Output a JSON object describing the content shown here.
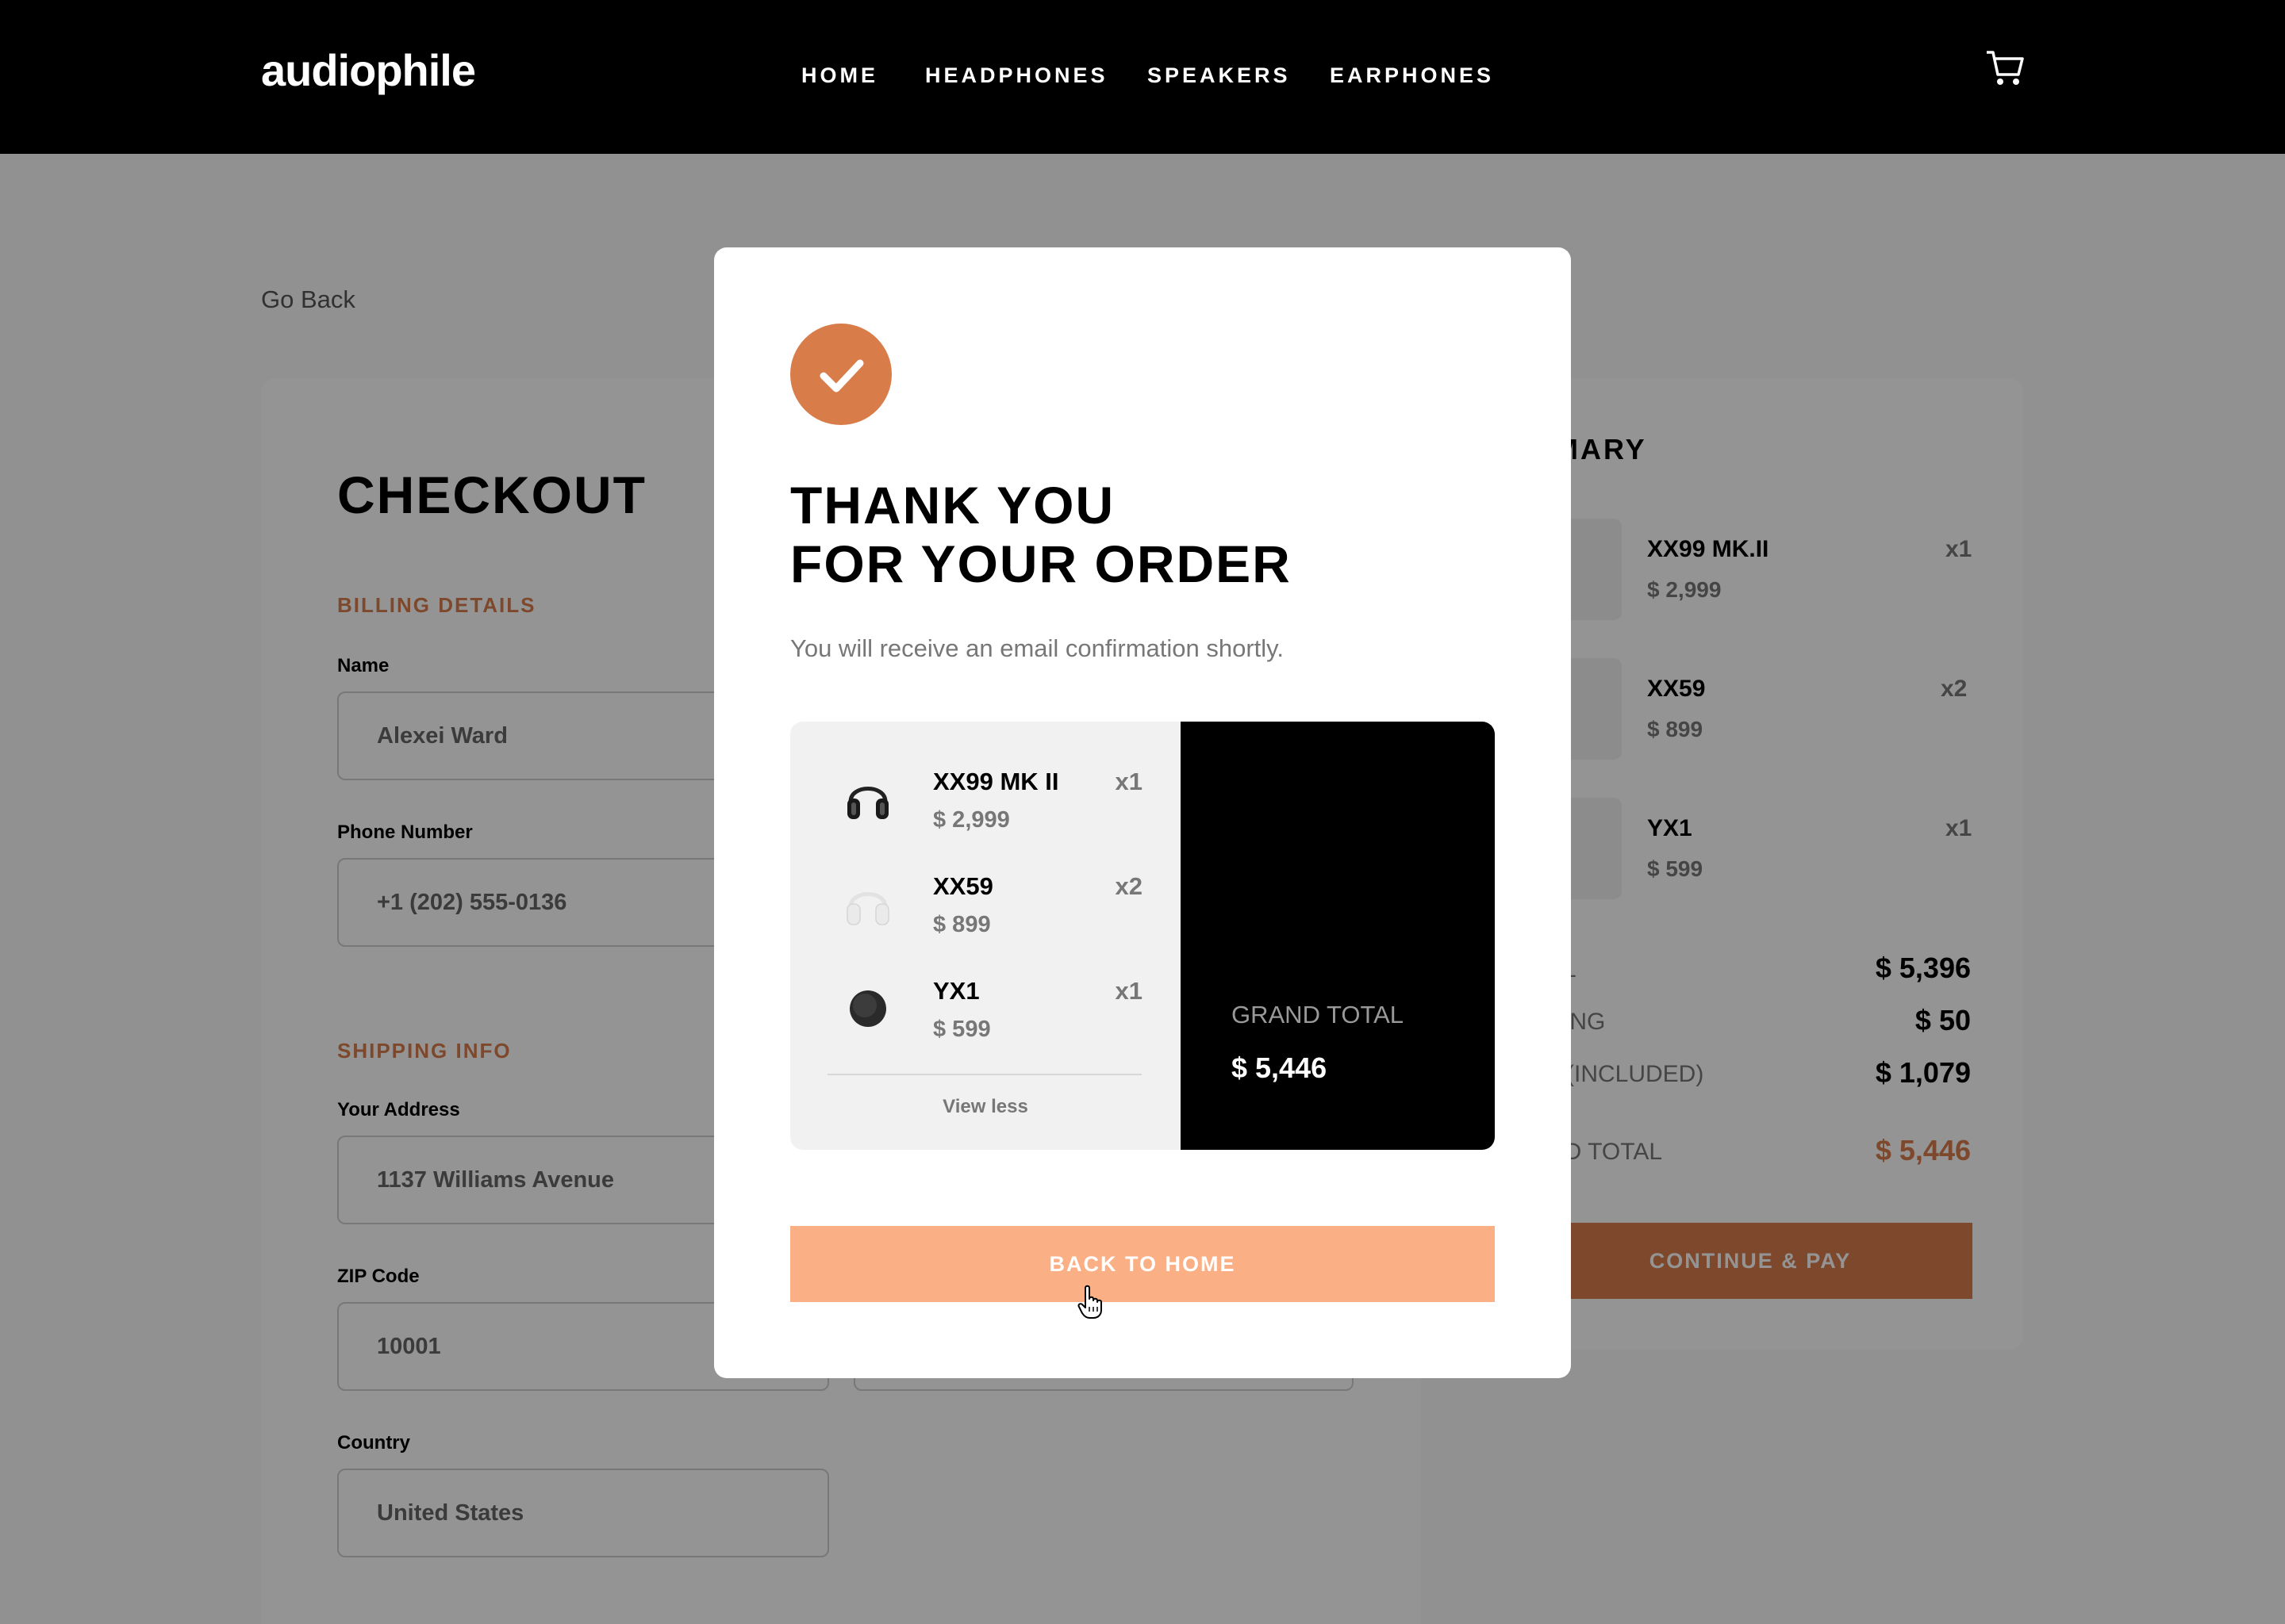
{
  "header": {
    "logo": "audiophile",
    "nav": [
      "HOME",
      "HEADPHONES",
      "SPEAKERS",
      "EARPHONES"
    ],
    "cart_icon": "cart-icon"
  },
  "page": {
    "go_back": "Go Back",
    "checkout_title": "CHECKOUT",
    "billing": {
      "section_title": "BILLING DETAILS",
      "name_label": "Name",
      "name_value": "Alexei Ward",
      "phone_label": "Phone Number",
      "phone_value": "+1 (202) 555-0136"
    },
    "shipping": {
      "section_title": "SHIPPING INFO",
      "address_label": "Your Address",
      "address_value": "1137 Williams Avenue",
      "zip_label": "ZIP Code",
      "zip_value": "10001",
      "country_label": "Country",
      "country_value": "United States"
    }
  },
  "summary": {
    "title": "MMARY",
    "items": [
      {
        "name": "XX99 MK.II",
        "price": "$ 2,999",
        "qty": "x1"
      },
      {
        "name": "XX59",
        "price": "$ 899",
        "qty": "x2"
      },
      {
        "name": "YX1",
        "price": "$ 599",
        "qty": "x1"
      }
    ],
    "rows": [
      {
        "label": "AL",
        "value": "$ 5,396"
      },
      {
        "label": "PING",
        "value": "$ 50"
      },
      {
        "label": "(INCLUDED)",
        "value": "$ 1,079"
      }
    ],
    "grand_label": "ND TOTAL",
    "grand_value": "$ 5,446",
    "continue_label": "CONTINUE & PAY"
  },
  "modal": {
    "title_line1": "THANK YOU",
    "title_line2": "FOR YOUR ORDER",
    "subtitle": "You will receive an email confirmation shortly.",
    "items": [
      {
        "name": "XX99 MK II",
        "price": "$ 2,999",
        "qty": "x1"
      },
      {
        "name": "XX59",
        "price": "$ 899",
        "qty": "x2"
      },
      {
        "name": "YX1",
        "price": "$ 599",
        "qty": "x1"
      }
    ],
    "view_less": "View less",
    "grand_total_label": "GRAND TOTAL",
    "grand_total_value": "$ 5,446",
    "back_button": "BACK TO HOME"
  },
  "colors": {
    "accent": "#d87d4a",
    "accent_light": "#fbaf85",
    "header_bg": "#000000"
  }
}
